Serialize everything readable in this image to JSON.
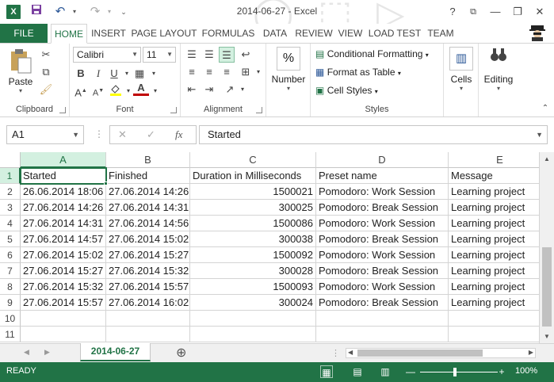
{
  "window": {
    "title": "2014-06-27 - Excel",
    "app_icon": "excel-icon",
    "help": "?",
    "minimize": "—",
    "restore": "❐",
    "close": "✕"
  },
  "qat": {
    "save": "save-icon",
    "undo": "undo-icon",
    "redo": "redo-icon"
  },
  "tabs": {
    "file": "FILE",
    "items": [
      "HOME",
      "INSERT",
      "PAGE LAYOUT",
      "FORMULAS",
      "DATA",
      "REVIEW",
      "VIEW",
      "LOAD TEST",
      "TEAM"
    ],
    "active": "HOME"
  },
  "ribbon": {
    "clipboard": {
      "label": "Clipboard",
      "paste": "Paste"
    },
    "font": {
      "label": "Font",
      "family": "Calibri",
      "size": "11",
      "bold": "B",
      "italic": "I",
      "underline": "U",
      "font_color": "#c00000",
      "highlight_color": "#ffff00"
    },
    "alignment": {
      "label": "Alignment"
    },
    "number": {
      "label": "Number",
      "symbol": "%"
    },
    "styles": {
      "label": "Styles",
      "conditional": "Conditional Formatting",
      "format_table": "Format as Table",
      "cell_styles": "Cell Styles"
    },
    "cells": {
      "label": "Cells"
    },
    "editing": {
      "label": "Editing"
    }
  },
  "formula_bar": {
    "name_box": "A1",
    "cancel": "✕",
    "enter": "✓",
    "fx": "fx",
    "content": "Started"
  },
  "sheet": {
    "columns": [
      "A",
      "B",
      "C",
      "D",
      "E"
    ],
    "selected_cell": "A1",
    "rows": [
      {
        "n": "1",
        "cells": [
          "Started",
          "Finished",
          "Duration in Milliseconds",
          "Preset name",
          "Message"
        ]
      },
      {
        "n": "2",
        "cells": [
          "26.06.2014 18:06",
          "27.06.2014 14:26",
          "1500021",
          "Pomodoro: Work Session",
          "Learning project"
        ]
      },
      {
        "n": "3",
        "cells": [
          "27.06.2014 14:26",
          "27.06.2014 14:31",
          "300025",
          "Pomodoro: Break Session",
          "Learning project"
        ]
      },
      {
        "n": "4",
        "cells": [
          "27.06.2014 14:31",
          "27.06.2014 14:56",
          "1500086",
          "Pomodoro: Work Session",
          "Learning project"
        ]
      },
      {
        "n": "5",
        "cells": [
          "27.06.2014 14:57",
          "27.06.2014 15:02",
          "300038",
          "Pomodoro: Break Session",
          "Learning project"
        ]
      },
      {
        "n": "6",
        "cells": [
          "27.06.2014 15:02",
          "27.06.2014 15:27",
          "1500092",
          "Pomodoro: Work Session",
          "Learning project"
        ]
      },
      {
        "n": "7",
        "cells": [
          "27.06.2014 15:27",
          "27.06.2014 15:32",
          "300028",
          "Pomodoro: Break Session",
          "Learning project"
        ]
      },
      {
        "n": "8",
        "cells": [
          "27.06.2014 15:32",
          "27.06.2014 15:57",
          "1500093",
          "Pomodoro: Work Session",
          "Learning project"
        ]
      },
      {
        "n": "9",
        "cells": [
          "27.06.2014 15:57",
          "27.06.2014 16:02",
          "300024",
          "Pomodoro: Break Session",
          "Learning project"
        ]
      },
      {
        "n": "10",
        "cells": [
          "",
          "",
          "",
          "",
          ""
        ]
      },
      {
        "n": "11",
        "cells": [
          "",
          "",
          "",
          "",
          ""
        ]
      }
    ]
  },
  "sheet_tabs": {
    "active": "2014-06-27",
    "add": "⊕"
  },
  "status": {
    "text": "READY",
    "zoom": "100%",
    "zoom_minus": "—",
    "zoom_plus": "+",
    "zoom_level": 1.0
  },
  "colors": {
    "accent": "#217346"
  }
}
